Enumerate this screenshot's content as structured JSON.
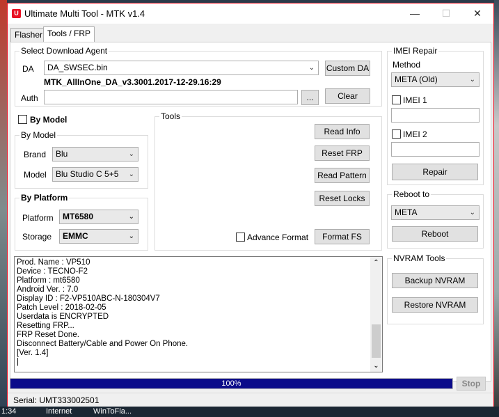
{
  "window": {
    "title": "Ultimate Multi Tool - MTK v1.4",
    "minimize": "—",
    "maximize": "☐",
    "close": "✕",
    "accent": "#e81123"
  },
  "tabs": [
    {
      "label": "Flasher"
    },
    {
      "label": "Tools / FRP"
    }
  ],
  "download_agent": {
    "legend": "Select Download Agent",
    "da_label": "DA",
    "da_value": "DA_SWSEC.bin",
    "da_file": "MTK_AllInOne_DA_v3.3001.2017-12-29.16:29",
    "auth_label": "Auth",
    "auth_value": "",
    "browse": "...",
    "custom_da": "Custom DA",
    "clear": "Clear"
  },
  "by_model_checkbox": "By Model",
  "by_model": {
    "legend": "By Model",
    "brand_label": "Brand",
    "brand_value": "Blu",
    "model_label": "Model",
    "model_value": "Blu Studio C 5+5"
  },
  "by_platform": {
    "legend": "By Platform",
    "platform_label": "Platform",
    "platform_value": "MT6580",
    "storage_label": "Storage",
    "storage_value": "EMMC"
  },
  "tools": {
    "legend": "Tools",
    "read_info": "Read Info",
    "reset_frp": "Reset FRP",
    "read_pattern": "Read Pattern",
    "reset_locks": "Reset Locks",
    "advance_format": "Advance Format",
    "format_fs": "Format FS"
  },
  "imei_repair": {
    "legend": "IMEI Repair",
    "method_label": "Method",
    "method_value": "META (Old)",
    "imei1_label": "IMEI 1",
    "imei2_label": "IMEI 2",
    "repair": "Repair"
  },
  "reboot": {
    "legend": "Reboot to",
    "mode_value": "META",
    "reboot": "Reboot"
  },
  "nvram": {
    "legend": "NVRAM Tools",
    "backup": "Backup NVRAM",
    "restore": "Restore NVRAM"
  },
  "log": [
    "Prod. Name : VP510",
    "Device : TECNO-F2",
    "Platform : mt6580",
    "Android Ver. : 7.0",
    "Display ID : F2-VP510ABC-N-180304V7",
    "Patch Level : 2018-02-05",
    "Userdata is ENCRYPTED",
    "Resetting FRP...",
    "FRP Reset Done.",
    "Disconnect Battery/Cable and Power On Phone.",
    "[Ver. 1.4]",
    "|"
  ],
  "progress": {
    "percent": 100,
    "label": "100%",
    "stop": "Stop",
    "fill_color": "#0b0b8a"
  },
  "status": {
    "serial": "Serial: UMT333002501"
  },
  "desktop": {
    "taskbar_items": [
      "1:34",
      "Internet",
      "WinToFla..."
    ]
  }
}
